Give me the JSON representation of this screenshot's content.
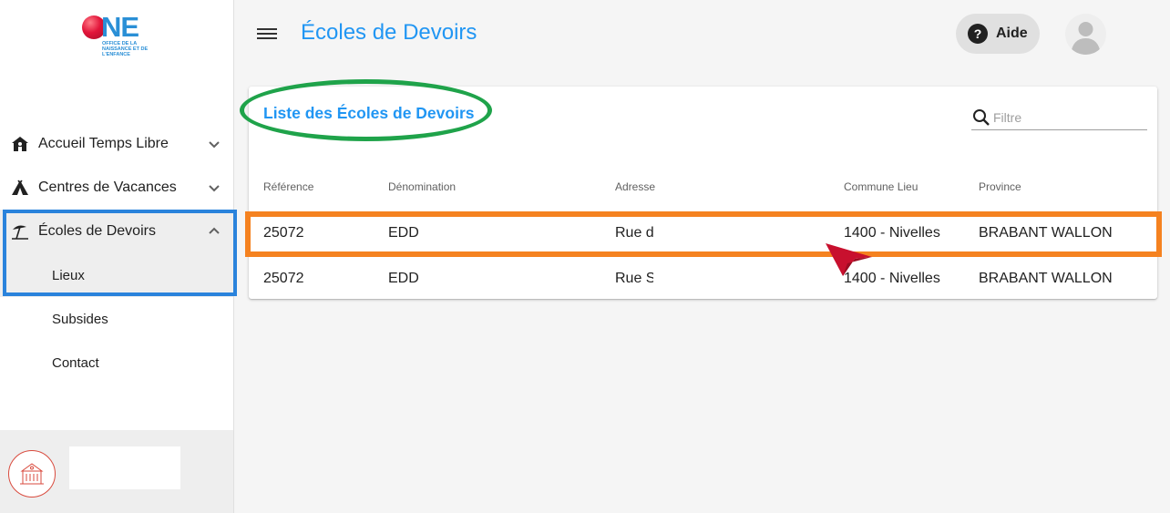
{
  "logo": {
    "brand": "NE",
    "subtitle": "OFFICE DE LA NAISSANCE ET DE L'ENFANCE"
  },
  "sidebar": {
    "items": [
      {
        "label": "Accueil Temps Libre",
        "icon": "house-icon"
      },
      {
        "label": "Centres de Vacances",
        "icon": "tent-icon"
      },
      {
        "label": "Écoles de Devoirs",
        "icon": "beach-umbrella-icon"
      }
    ],
    "subitems": [
      {
        "label": "Lieux"
      },
      {
        "label": "Subsides"
      },
      {
        "label": "Contact"
      }
    ]
  },
  "header": {
    "title": "Écoles de Devoirs",
    "help_label": "Aide"
  },
  "card": {
    "title": "Liste des Écoles de Devoirs",
    "filter_placeholder": "Filtre",
    "columns": [
      "Référence",
      "Dénomination",
      "Adresse",
      "Commune Lieu",
      "Province"
    ],
    "rows": [
      [
        "25072",
        "EDD",
        "Rue d",
        "1400 - Nivelles",
        "BRABANT  WALLON"
      ],
      [
        "25072",
        "EDD",
        "Rue Sa",
        "1400 - Nivelles",
        "BRABANT  WALLON"
      ]
    ]
  },
  "colors": {
    "accent": "#2196f3",
    "highlight_blue": "#2a83dc",
    "highlight_green": "#1fa34a",
    "highlight_orange": "#f58220",
    "cursor": "#c8102e"
  }
}
